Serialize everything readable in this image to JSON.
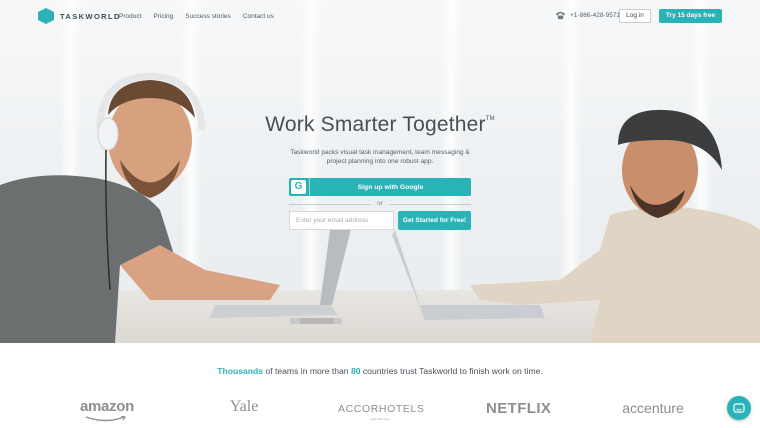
{
  "header": {
    "logo_text": "TASKWORLD",
    "nav": [
      "Product",
      "Pricing",
      "Success stories",
      "Contact us"
    ],
    "phone": "+1-866-428-9571",
    "login_label": "Log in",
    "trial_label": "Try 15 days free"
  },
  "hero": {
    "headline": "Work Smarter Together",
    "trademark": "TM",
    "subhead": "Taskworld packs visual task management, team messaging & project planning into one robust app.",
    "google_label": "Sign up with Google",
    "google_icon_glyph": "G",
    "or_text": "or",
    "email_placeholder": "Enter your email address",
    "start_label": "Get Started for Free!"
  },
  "trust": {
    "prefix_highlight": "Thousands",
    "middle": " of teams in more than ",
    "count_highlight": "80",
    "suffix": " countries trust Taskworld to finish work on time."
  },
  "brands": {
    "amazon": "amazon",
    "yale": "Yale",
    "accor": "ACCORHOTELS",
    "accor_sub": "Feel Welcome",
    "netflix": "NETFLIX",
    "accenture": "accenture"
  },
  "colors": {
    "accent": "#2ab3b6",
    "text_dark": "#4a4f54"
  },
  "icons": {
    "phone": "phone-icon",
    "chat": "chat-icon",
    "google": "google-icon",
    "logo": "taskworld-logo-icon"
  }
}
